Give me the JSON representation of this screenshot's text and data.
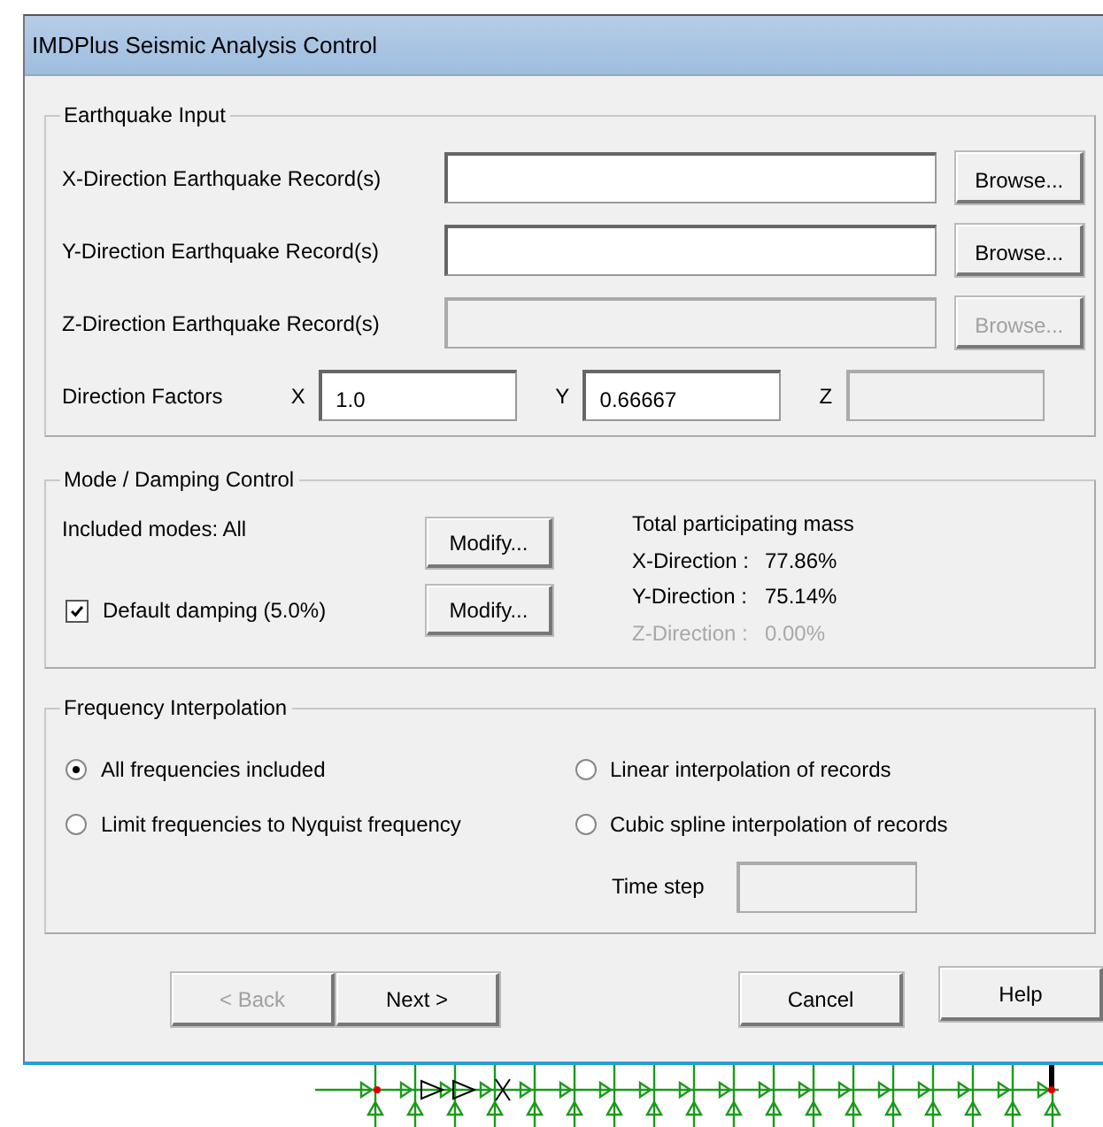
{
  "window": {
    "title": "IMDPlus Seismic Analysis Control"
  },
  "earthquake_input": {
    "title": "Earthquake Input",
    "records": [
      {
        "label": "X-Direction Earthquake Record(s)",
        "disabled": false,
        "button": "Browse..."
      },
      {
        "label": "Y-Direction Earthquake Record(s)",
        "disabled": false,
        "button": "Browse..."
      },
      {
        "label": "Z-Direction Earthquake Record(s)",
        "disabled": true,
        "button": "Browse..."
      }
    ],
    "direction_factors": {
      "label": "Direction Factors",
      "fields": [
        {
          "axis": "X",
          "value": "1.0",
          "disabled": false
        },
        {
          "axis": "Y",
          "value": "0.66667",
          "disabled": false
        },
        {
          "axis": "Z",
          "disabled": true
        }
      ]
    }
  },
  "mode_damping": {
    "title": "Mode / Damping Control",
    "included_modes": "Included modes: All",
    "modes_button": "Modify...",
    "damping": {
      "label": "Default damping (5.0%)",
      "checked": true,
      "button": "Modify..."
    },
    "mass": {
      "title": "Total participating mass",
      "rows": [
        {
          "label": "X-Direction :",
          "value": "77.86%",
          "disabled": false
        },
        {
          "label": "Y-Direction :",
          "value": "75.14%",
          "disabled": false
        },
        {
          "label": "Z-Direction :",
          "value": "0.00%",
          "disabled": true
        }
      ]
    }
  },
  "frequency_interpolation": {
    "title": "Frequency Interpolation",
    "frequency_options": [
      {
        "label": "All frequencies included",
        "selected": true
      },
      {
        "label": "Limit frequencies to Nyquist frequency",
        "selected": false
      }
    ],
    "interpolation_options": [
      {
        "label": "Linear interpolation of records",
        "selected": false
      },
      {
        "label": "Cubic spline interpolation of records",
        "selected": false
      }
    ],
    "time_step": {
      "label": "Time step",
      "disabled": true
    }
  },
  "buttons": [
    {
      "label": "< Back",
      "disabled": true
    },
    {
      "label": "Next >",
      "disabled": false
    },
    {
      "label": "Cancel",
      "disabled": false
    },
    {
      "label": "Help",
      "disabled": false
    }
  ]
}
